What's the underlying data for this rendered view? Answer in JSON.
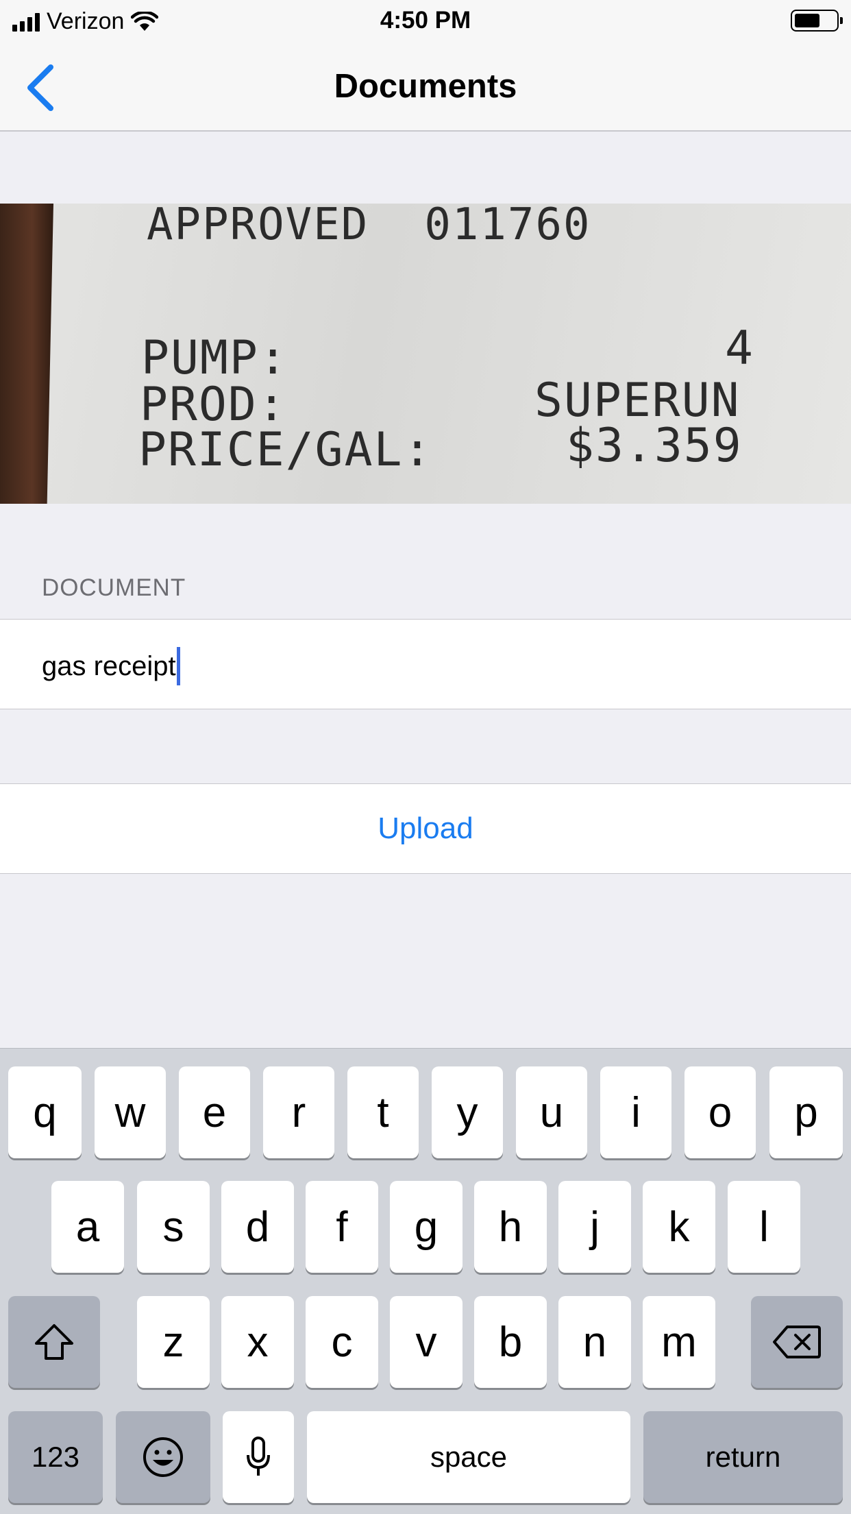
{
  "status_bar": {
    "carrier": "Verizon",
    "time": "4:50 PM"
  },
  "nav": {
    "title": "Documents",
    "back_icon": "chevron-left-icon",
    "accent": "#1a7cf0"
  },
  "receipt_image": {
    "lines": [
      "APPROVED  011760",
      "PUMP:",
      "4",
      "PROD:",
      "SUPERUN",
      "PRICE/GAL:",
      "$3.359"
    ]
  },
  "section": {
    "header": "DOCUMENT"
  },
  "document_field": {
    "value": "gas receipt"
  },
  "upload": {
    "label": "Upload"
  },
  "keyboard": {
    "row1": [
      "q",
      "w",
      "e",
      "r",
      "t",
      "y",
      "u",
      "i",
      "o",
      "p"
    ],
    "row2": [
      "a",
      "s",
      "d",
      "f",
      "g",
      "h",
      "j",
      "k",
      "l"
    ],
    "row3": [
      "z",
      "x",
      "c",
      "v",
      "b",
      "n",
      "m"
    ],
    "numbers_label": "123",
    "space_label": "space",
    "return_label": "return",
    "shift_icon": "shift-icon",
    "delete_icon": "delete-icon",
    "emoji_icon": "emoji-icon",
    "mic_icon": "microphone-icon"
  }
}
